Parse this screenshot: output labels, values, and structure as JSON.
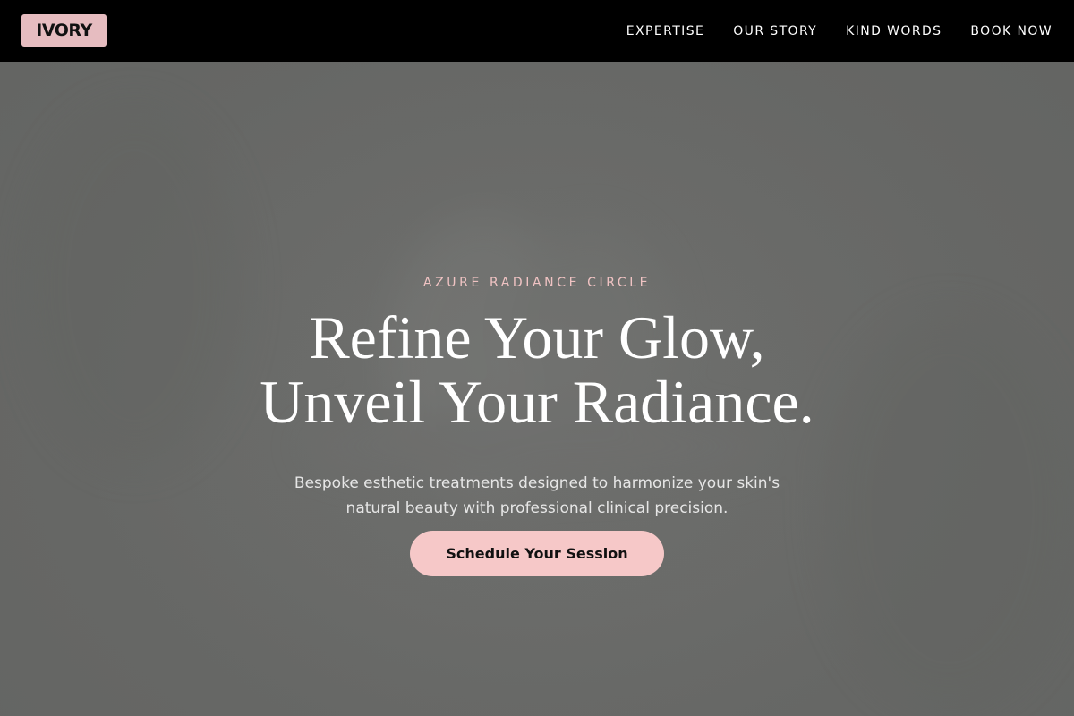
{
  "brand": {
    "logo_text": "IVORY",
    "logo_color": "#e6bcc0"
  },
  "nav": {
    "items": [
      {
        "label": "EXPERTISE"
      },
      {
        "label": "OUR STORY"
      },
      {
        "label": "KIND WORDS"
      },
      {
        "label": "BOOK NOW"
      }
    ]
  },
  "hero": {
    "eyebrow": "AZURE RADIANCE CIRCLE",
    "headline_line1": "Refine Your Glow,",
    "headline_line2": "Unveil Your Radiance.",
    "subtext_line1": "Bespoke esthetic treatments designed to harmonize your skin's",
    "subtext_line2": "natural beauty with professional clinical precision.",
    "cta_label": "Schedule Your Session",
    "accent_color": "#f6c8c8",
    "overlay_color": "#666765"
  }
}
